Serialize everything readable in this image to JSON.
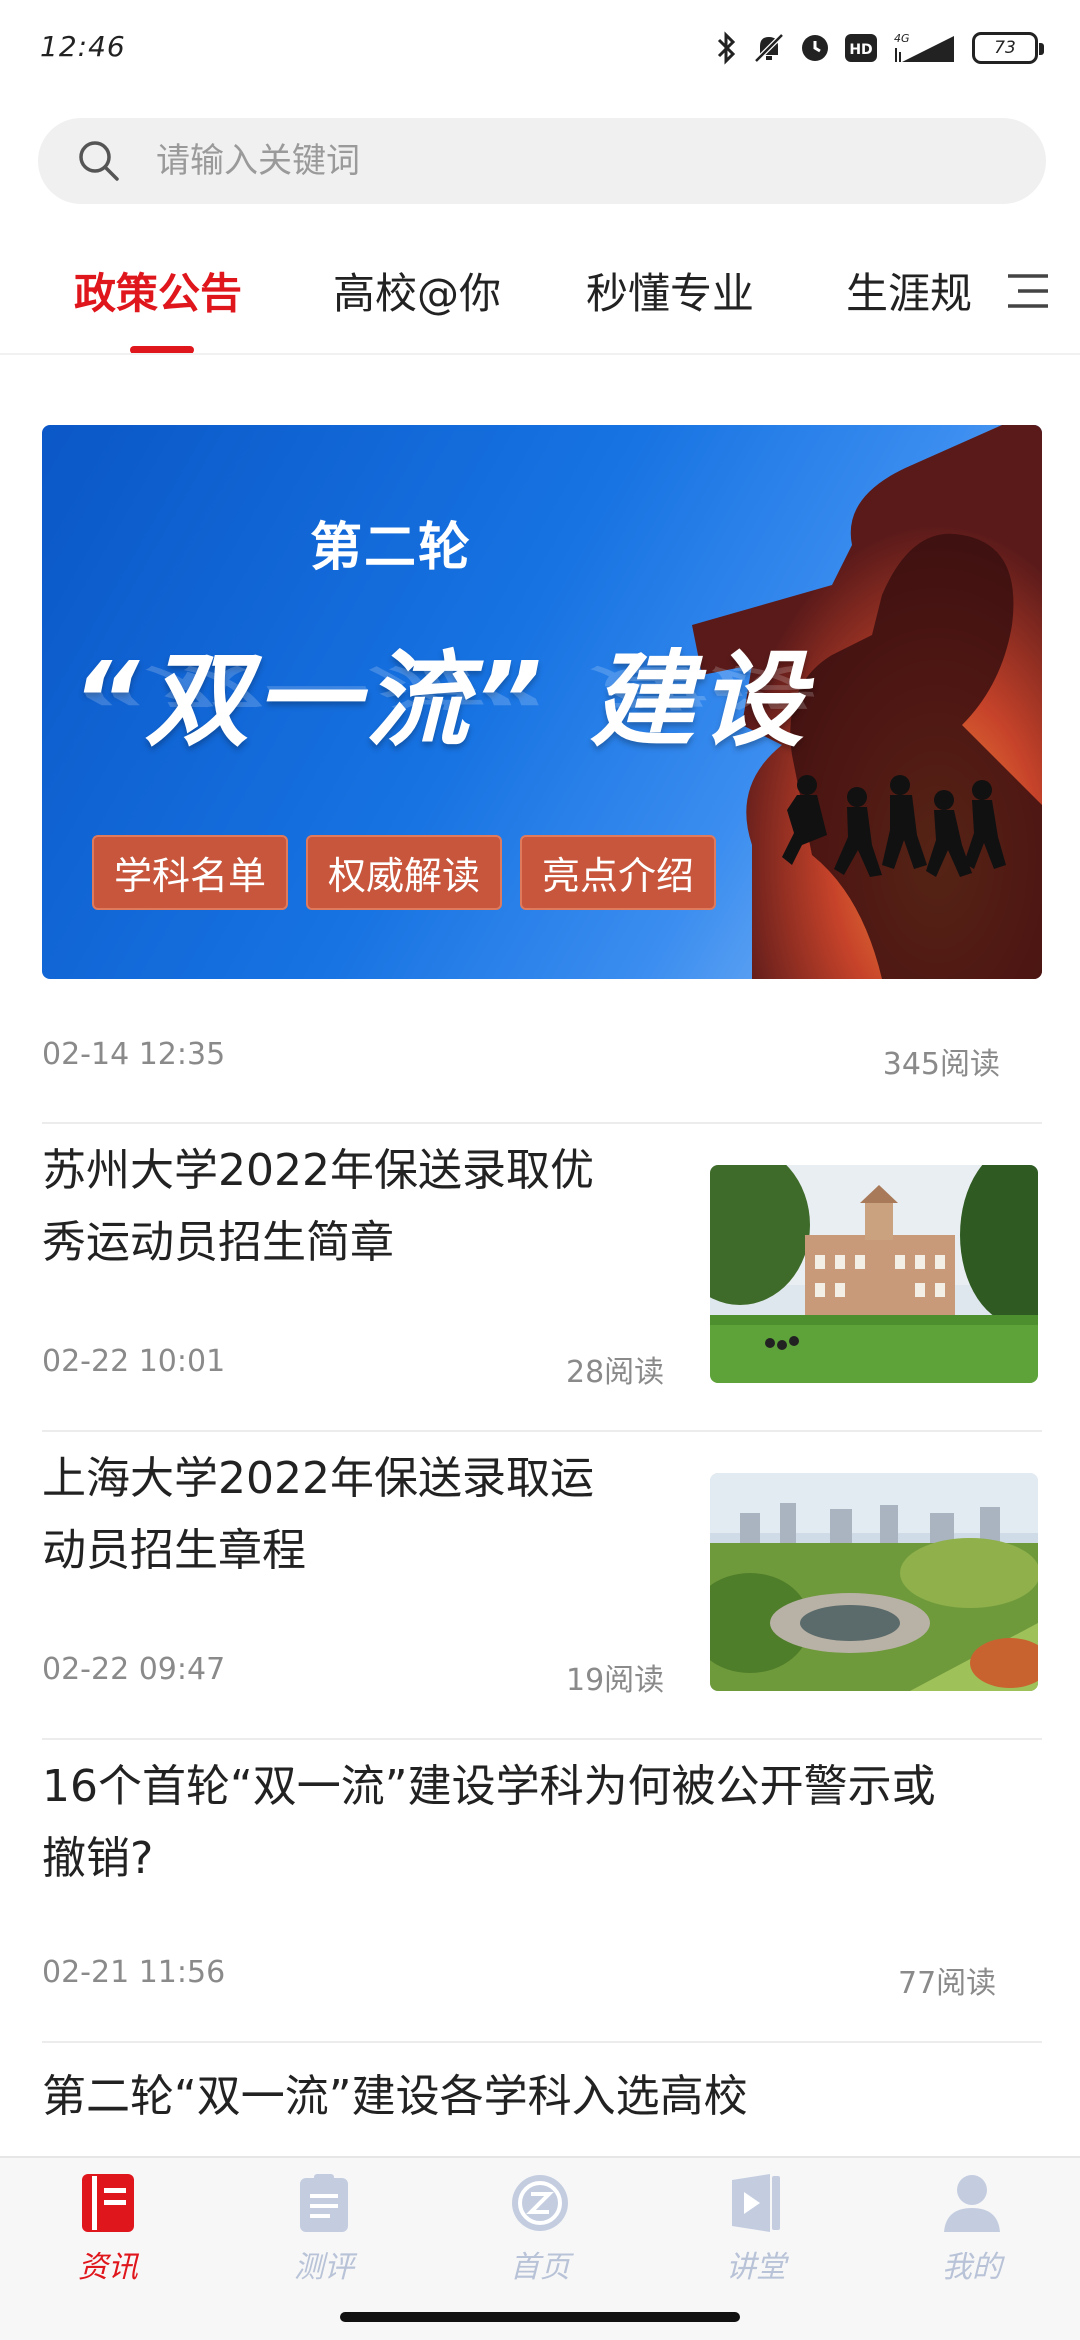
{
  "status_bar": {
    "time": "12:46",
    "network": "4G",
    "battery": "73"
  },
  "search": {
    "placeholder": "请输入关键词"
  },
  "tabs": [
    {
      "label": "政策公告",
      "active": true
    },
    {
      "label": "高校@你",
      "active": false
    },
    {
      "label": "秒懂专业",
      "active": false
    },
    {
      "label": "生涯规",
      "active": false
    }
  ],
  "banner": {
    "subtitle": "第二轮",
    "title": "“双一流” 建设",
    "tags": [
      "学科名单",
      "权威解读",
      "亮点介绍"
    ],
    "date": "02-14 12:35",
    "reads": "345阅读"
  },
  "articles": [
    {
      "title_line1": "苏州大学2022年保送录取优",
      "title_line2": "秀运动员招生简章",
      "date": "02-22 10:01",
      "reads": "28阅读",
      "thumb": "campus-lawn"
    },
    {
      "title_line1": "上海大学2022年保送录取运",
      "title_line2": "动员招生章程",
      "date": "02-22 09:47",
      "reads": "19阅读",
      "thumb": "campus-aerial"
    },
    {
      "title_line1": "16个首轮“双一流”建设学科为何被公开警示或",
      "title_line2": "撤销?",
      "date": "02-21 11:56",
      "reads": "77阅读"
    },
    {
      "title_line1": "第二轮“双一流”建设各学科入选高校"
    }
  ],
  "bottom_nav": [
    {
      "label": "资讯",
      "icon": "news-book-icon",
      "active": true
    },
    {
      "label": "测评",
      "icon": "clipboard-icon",
      "active": false
    },
    {
      "label": "首页",
      "icon": "home-logo-icon",
      "active": false
    },
    {
      "label": "讲堂",
      "icon": "video-play-icon",
      "active": false
    },
    {
      "label": "我的",
      "icon": "user-icon",
      "active": false
    }
  ],
  "colors": {
    "accent": "#e0161d",
    "inactive_nav": "#b9c3d8"
  }
}
